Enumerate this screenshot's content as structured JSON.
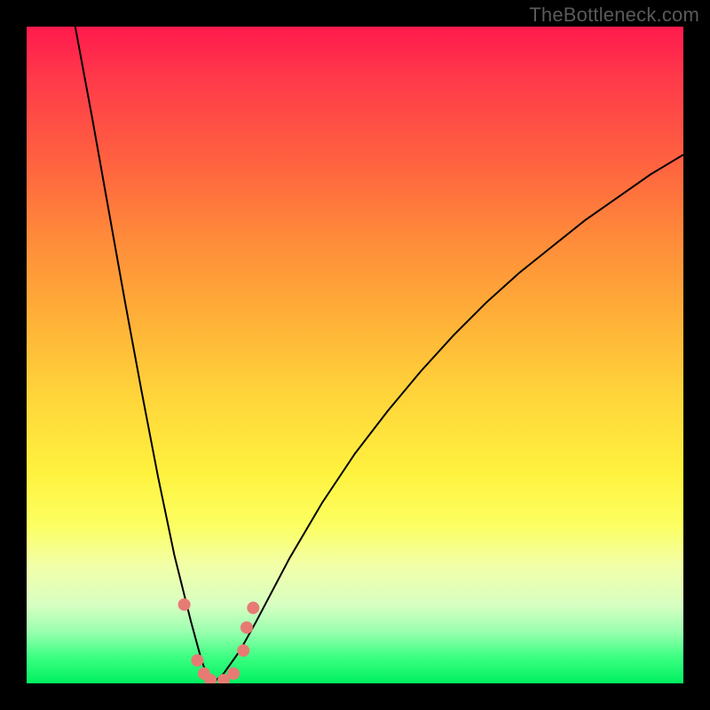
{
  "watermark": "TheBottleneck.com",
  "colors": {
    "frame": "#000000",
    "curve": "#000000",
    "point": "#e77b74",
    "gradient_top": "#ff1a4d",
    "gradient_bottom": "#00f060"
  },
  "chart_data": {
    "type": "line",
    "title": "",
    "xlabel": "",
    "ylabel": "",
    "xlim": [
      0,
      100
    ],
    "ylim": [
      0,
      100
    ],
    "note": "Axes are implicit (no tick labels shown). x maps left→right across the colored square; y maps bottom (green, 0) → top (red, 100). Values estimated from pixel positions.",
    "series": [
      {
        "name": "left-branch",
        "x": [
          7.4,
          10.0,
          12.5,
          15.0,
          17.5,
          20.0,
          22.5,
          25.0,
          26.5,
          27.5,
          28.3
        ],
        "y": [
          100.0,
          86.0,
          72.0,
          58.0,
          44.5,
          31.5,
          19.5,
          9.5,
          4.0,
          1.0,
          0.0
        ]
      },
      {
        "name": "right-branch",
        "x": [
          28.3,
          30.0,
          32.5,
          35.0,
          40.0,
          45.0,
          50.0,
          55.0,
          60.0,
          65.0,
          70.0,
          75.0,
          80.0,
          85.0,
          90.0,
          95.0,
          100.0
        ],
        "y": [
          0.0,
          1.5,
          5.0,
          9.5,
          19.0,
          27.5,
          35.0,
          41.5,
          47.5,
          53.0,
          58.0,
          62.5,
          66.5,
          70.5,
          74.0,
          77.5,
          80.5
        ]
      }
    ],
    "points": [
      {
        "x": 24.0,
        "y": 12.0
      },
      {
        "x": 26.0,
        "y": 3.5
      },
      {
        "x": 27.0,
        "y": 1.5
      },
      {
        "x": 28.0,
        "y": 0.5
      },
      {
        "x": 30.0,
        "y": 0.5
      },
      {
        "x": 31.5,
        "y": 1.5
      },
      {
        "x": 33.0,
        "y": 5.0
      },
      {
        "x": 33.5,
        "y": 8.5
      },
      {
        "x": 34.5,
        "y": 11.5
      }
    ]
  }
}
